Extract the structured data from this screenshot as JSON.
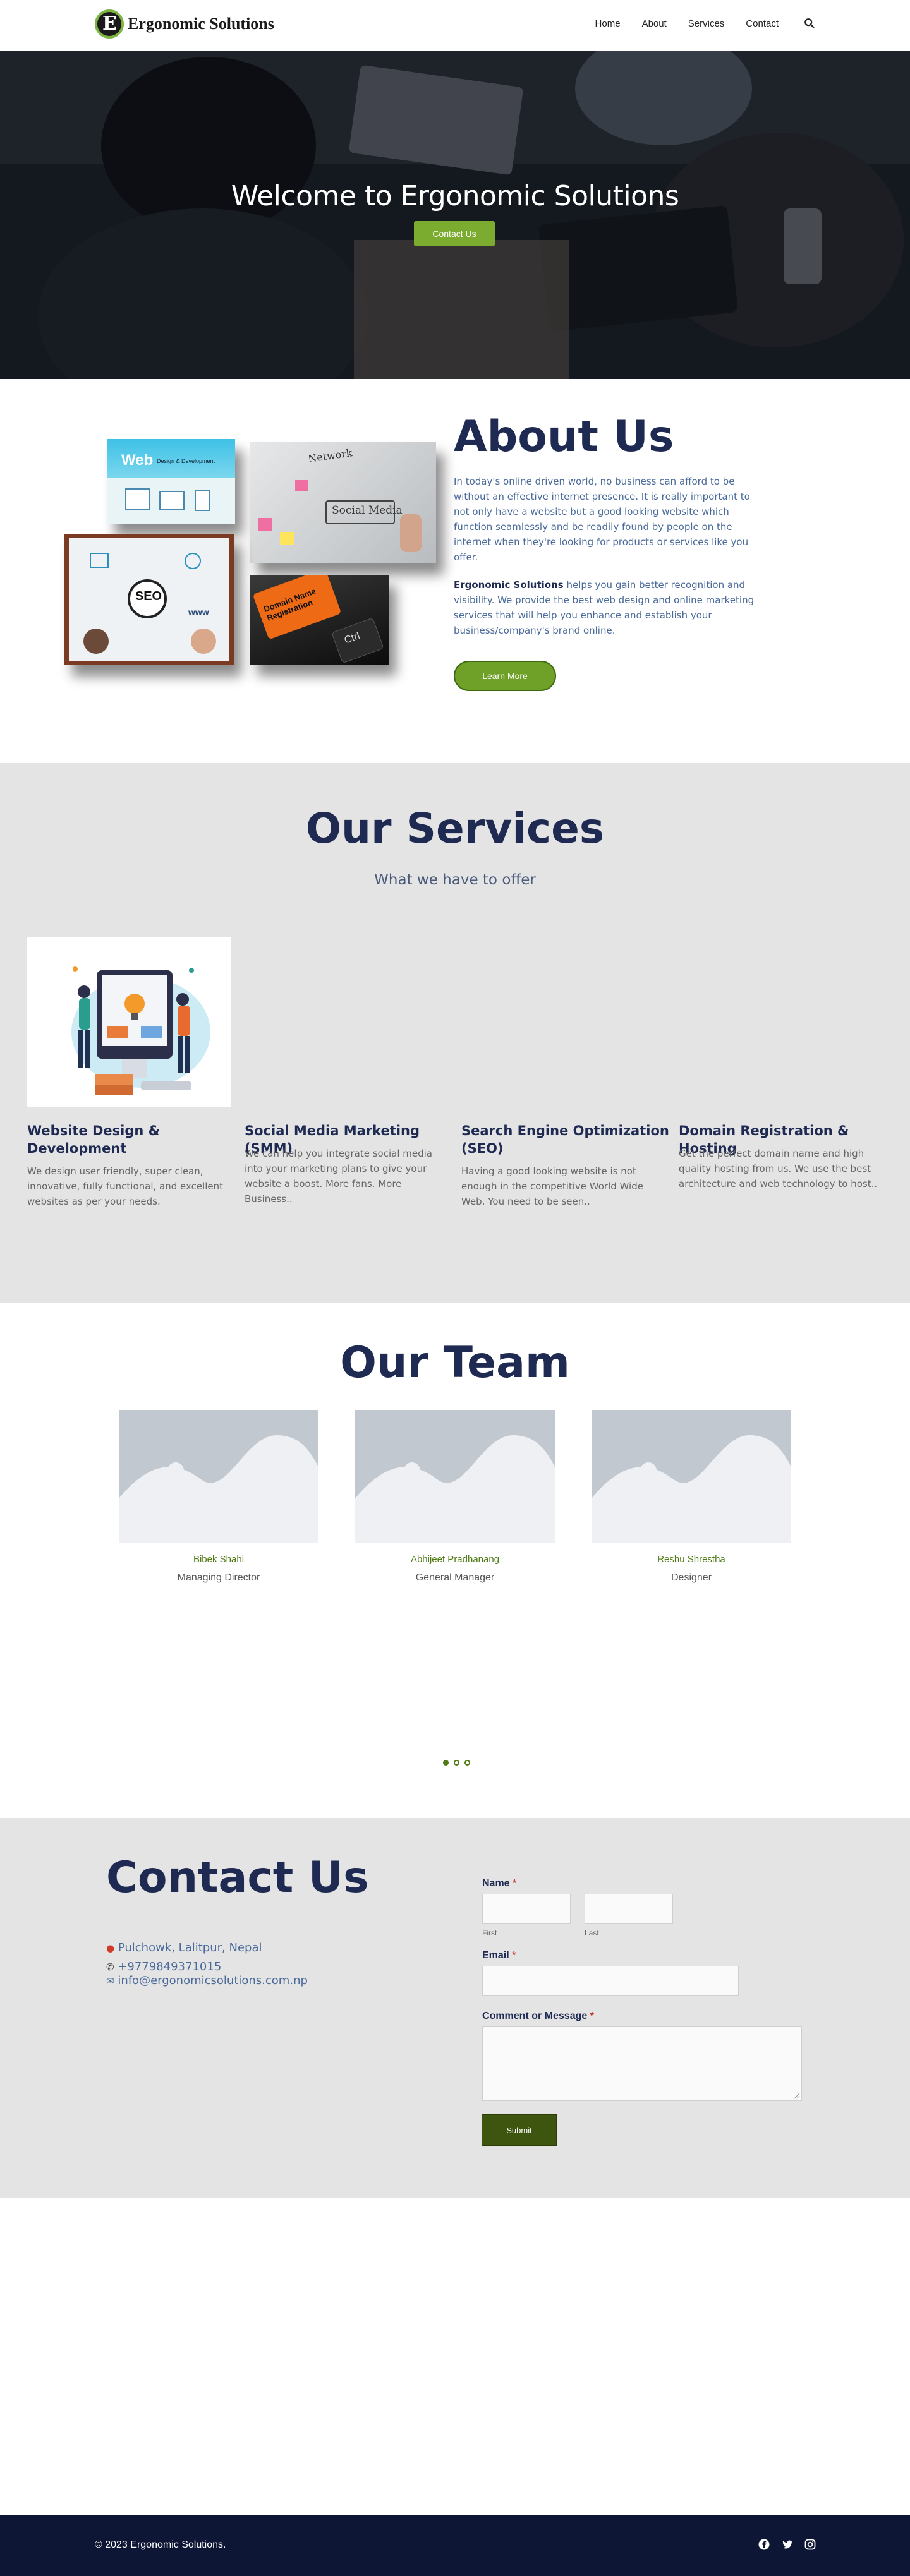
{
  "header": {
    "logo_letter": "E",
    "logo_text": "Ergonomic Solutions",
    "nav": [
      "Home",
      "About",
      "Services",
      "Contact"
    ]
  },
  "hero": {
    "title": "Welcome to Ergonomic Solutions",
    "button": "Contact Us"
  },
  "about": {
    "title": "About Us",
    "paragraph1": "In today's online driven world, no business can afford to be without an effective internet presence. It is really important to not only have a website but a good looking website which function seamlessly and be readily found by people on the internet when they're looking for products or services like you offer.",
    "company": "Ergonomic Solutions",
    "paragraph2": " helps you gain better recognition and visibility. We provide the best web design and online marketing services that will help you enhance and establish your business/company's brand online.",
    "button": "Learn More",
    "images": {
      "web_title": "Web",
      "web_sub": "Design & Development",
      "seo": "SEO",
      "www": "www",
      "social_title": "Social Media",
      "network": "Network",
      "domain": "Domain Name Registration",
      "ctrl": "Ctrl"
    }
  },
  "services": {
    "title": "Our Services",
    "subtitle": "What we have to offer",
    "items": [
      {
        "title": "Website Design & Development",
        "text": "We design user friendly, super clean, innovative, fully functional, and excellent websites as per your needs."
      },
      {
        "title": "Social Media Marketing (SMM)",
        "text": "We can help you integrate social media into your marketing plans to give your website a boost. More fans. More Business.."
      },
      {
        "title": "Search Engine Optimization (SEO)",
        "text": "Having a good looking website is not enough in the competitive World Wide Web. You need to be seen.."
      },
      {
        "title": "Domain Registration & Hosting",
        "text": "Get the perfect domain name and high quality hosting from us. We use the best architecture and web technology to host.."
      }
    ]
  },
  "team": {
    "title": "Our Team",
    "members": [
      {
        "name": "Bibek Shahi",
        "role": "Managing Director"
      },
      {
        "name": "Abhijeet Pradhanang",
        "role": "General Manager"
      },
      {
        "name": "Reshu Shrestha",
        "role": "Designer"
      }
    ],
    "carousel_active": 1,
    "carousel_count": 3
  },
  "contact": {
    "title": "Contact Us",
    "address": "Pulchowk, Lalitpur, Nepal",
    "phone": "+9779849371015",
    "email": "info@ergonomicsolutions.com.np",
    "form": {
      "name_label": "Name",
      "first": "First",
      "last": "Last",
      "email_label": "Email",
      "message_label": "Comment or Message",
      "required": "*",
      "submit": "Submit"
    }
  },
  "footer": {
    "copyright": "© 2023 Ergonomic Solutions."
  },
  "colors": {
    "navy": "#1f2a52",
    "green": "#7cac2f",
    "dark_green": "#3e5510",
    "footer": "#0e1635",
    "section_gray": "#e4e4e4"
  }
}
